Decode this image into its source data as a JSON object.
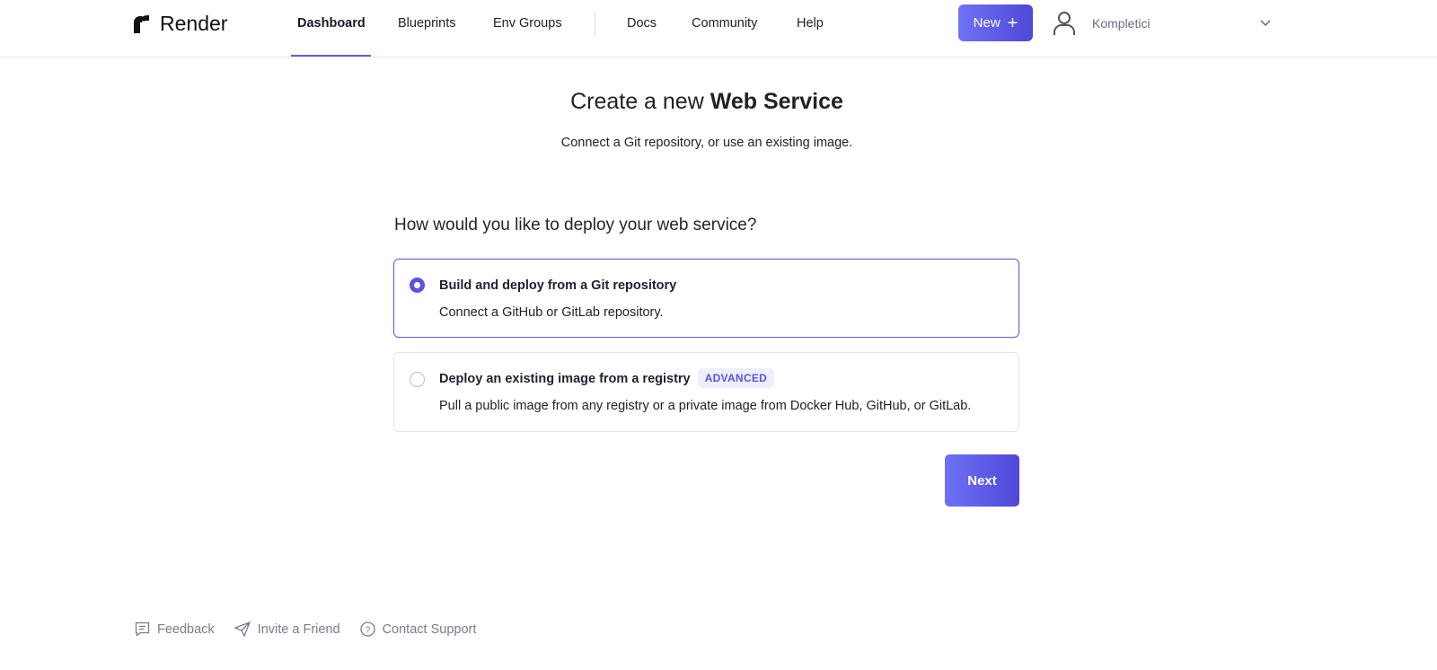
{
  "header": {
    "logo": "Render",
    "nav": [
      "Dashboard",
      "Blueprints",
      "Env Groups",
      "Docs",
      "Community",
      "Help"
    ],
    "active_nav": "Dashboard",
    "new_button": "New",
    "user": "Kompletici"
  },
  "main": {
    "title_prefix": "Create a new ",
    "title_bold": "Web Service",
    "subtitle": "Connect a Git repository, or use an existing image.",
    "question": "How would you like to deploy your web service?",
    "options": [
      {
        "title": "Build and deploy from a Git repository",
        "description": "Connect a GitHub or GitLab repository.",
        "selected": true
      },
      {
        "title": "Deploy an existing image from a registry",
        "badge": "ADVANCED",
        "description": "Pull a public image from any registry or a private image from Docker Hub, GitHub, or GitLab.",
        "selected": false
      }
    ],
    "next_button": "Next"
  },
  "footer": {
    "links": [
      "Feedback",
      "Invite a Friend",
      "Contact Support"
    ]
  },
  "colors": {
    "accent": "#5b54e0"
  }
}
